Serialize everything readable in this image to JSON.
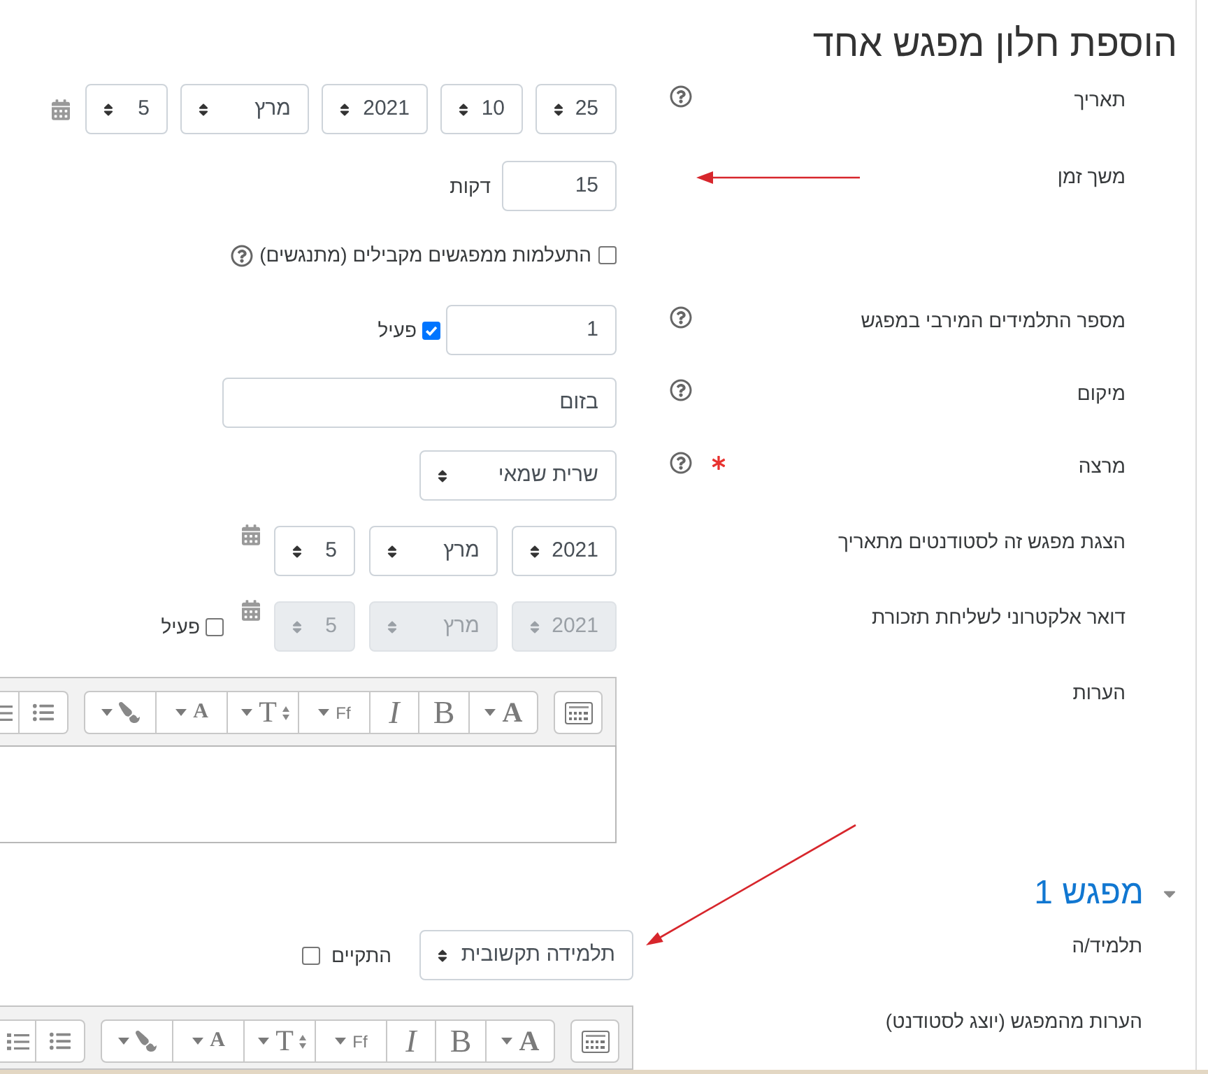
{
  "title": "הוספת חלון מפגש אחד",
  "fields": [
    {
      "kind": "datetime",
      "label": "תאריך",
      "help": true,
      "selects": [
        {
          "value": "25"
        },
        {
          "value": "10"
        },
        {
          "value": "2021"
        },
        {
          "value": "מרץ"
        },
        {
          "value": "5"
        }
      ]
    },
    {
      "kind": "duration",
      "label": "משך זמן",
      "value": "15",
      "unit": "דקות"
    },
    {
      "kind": "checkbox",
      "text": "התעלמות ממפגשים מקבילים (מתנגשים)",
      "checked": false,
      "help": true
    },
    {
      "kind": "number",
      "label": "מספר התלמידים המירבי במפגש",
      "help": true,
      "value": "1",
      "enable": {
        "label": "פעיל",
        "checked": true
      }
    },
    {
      "kind": "text",
      "label": "מיקום",
      "help": true,
      "value": "בזום"
    },
    {
      "kind": "select",
      "label": "מרצה",
      "required": true,
      "help": true,
      "value": "שרית שמאי"
    },
    {
      "kind": "date",
      "label": "הצגת מפגש זה לסטודנטים מתאריך",
      "disabled": false,
      "selects": [
        {
          "value": "2021"
        },
        {
          "value": "מרץ"
        },
        {
          "value": "5"
        }
      ]
    },
    {
      "kind": "date",
      "label": "דואר אלקטרוני לשליחת תזכורת",
      "disabled": true,
      "selects": [
        {
          "value": "2021"
        },
        {
          "value": "מרץ"
        },
        {
          "value": "5"
        }
      ],
      "enable": {
        "label": "פעיל",
        "checked": false
      }
    },
    {
      "kind": "editor",
      "label": "הערות",
      "toolbar": [
        {
          "buttons": [
            {
              "kind": "grid"
            }
          ]
        },
        {
          "buttons": [
            {
              "kind": "heading",
              "glyph": "A",
              "menu": true
            },
            {
              "kind": "bold",
              "glyph": "B"
            },
            {
              "kind": "italic",
              "glyph": "I"
            },
            {
              "kind": "family",
              "glyph": "Ff",
              "menu": true
            },
            {
              "kind": "size",
              "glyph": "T",
              "menu": true
            },
            {
              "kind": "color",
              "glyph": "A",
              "menu": true
            },
            {
              "kind": "brush",
              "menu": true
            }
          ]
        },
        {
          "buttons": [
            {
              "kind": "bullets"
            },
            {
              "kind": "numbered"
            }
          ]
        }
      ]
    }
  ],
  "section": {
    "title": "מפגש 1",
    "expanded": true,
    "fields": [
      {
        "kind": "select",
        "label": "תלמיד/ה",
        "value": "תלמידה תקשובית",
        "status": {
          "label": "התקיים",
          "checked": false
        }
      },
      {
        "kind": "editor",
        "label": "הערות מהמפגש (יוצג לסטודנט)",
        "toolbar": [
          {
            "buttons": [
              {
                "kind": "grid"
              }
            ]
          },
          {
            "buttons": [
              {
                "kind": "heading",
                "glyph": "A",
                "menu": true
              },
              {
                "kind": "bold",
                "glyph": "B"
              },
              {
                "kind": "italic",
                "glyph": "I"
              },
              {
                "kind": "family",
                "glyph": "Ff",
                "menu": true
              },
              {
                "kind": "size",
                "glyph": "T",
                "menu": true
              },
              {
                "kind": "color",
                "glyph": "A",
                "menu": true
              },
              {
                "kind": "brush",
                "menu": true
              }
            ]
          },
          {
            "buttons": [
              {
                "kind": "bullets"
              },
              {
                "kind": "numbered"
              }
            ]
          }
        ]
      }
    ]
  }
}
